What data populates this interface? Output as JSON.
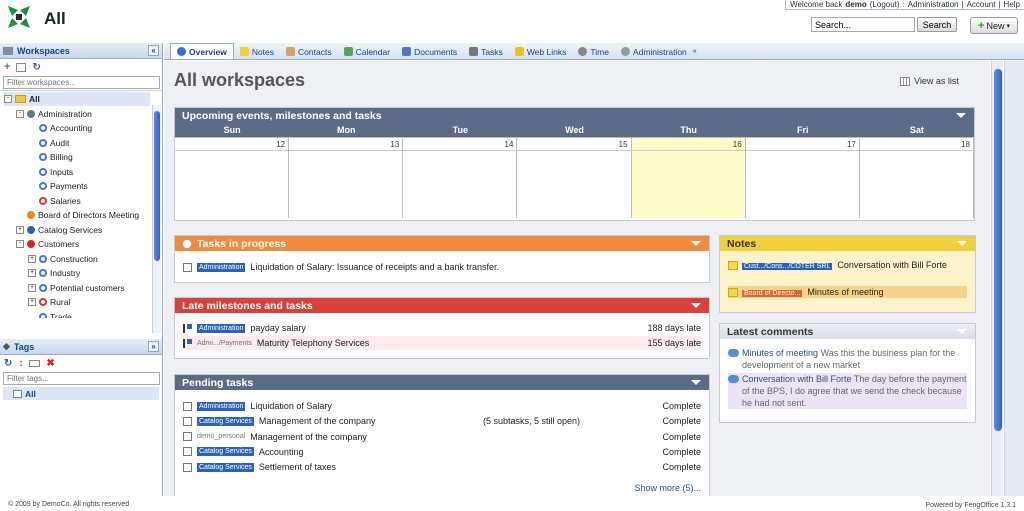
{
  "app": {
    "title": "All"
  },
  "userbar": {
    "welcome": "Welcome back",
    "user": "demo",
    "logout": "(Logout)",
    "sep1": ":",
    "admin": "Administration",
    "sep2": "|",
    "account": "Account",
    "sep3": "|",
    "help": "Help"
  },
  "search": {
    "value": "Search...",
    "button": "Search"
  },
  "new_button": {
    "label": "New"
  },
  "sidebar": {
    "workspaces_title": "Workspaces",
    "filter_placeholder": "Filter workspaces...",
    "tree": [
      {
        "label": "All",
        "level": 0,
        "exp": "-",
        "icon": "folder",
        "selected": true
      },
      {
        "label": "Administration",
        "level": 1,
        "exp": "-",
        "icon": "dot",
        "color": "#667788"
      },
      {
        "label": "Accounting",
        "level": 2,
        "exp": "",
        "icon": "ring",
        "color": "#4477cc"
      },
      {
        "label": "Audit",
        "level": 2,
        "exp": "",
        "icon": "ring",
        "color": "#4477cc"
      },
      {
        "label": "Billing",
        "level": 2,
        "exp": "",
        "icon": "ring",
        "color": "#4477cc"
      },
      {
        "label": "Inputs",
        "level": 2,
        "exp": "",
        "icon": "ring",
        "color": "#4477cc"
      },
      {
        "label": "Payments",
        "level": 2,
        "exp": "",
        "icon": "ring",
        "color": "#4477cc"
      },
      {
        "label": "Salaries",
        "level": 2,
        "exp": "",
        "icon": "ring",
        "color": "#dd3333"
      },
      {
        "label": "Board of Directors Meeting",
        "level": 1,
        "exp": "",
        "icon": "dot",
        "color": "#ee8822"
      },
      {
        "label": "Catalog Services",
        "level": 1,
        "exp": "+",
        "icon": "dot",
        "color": "#2d63b7"
      },
      {
        "label": "Customers",
        "level": 1,
        "exp": "-",
        "icon": "dot",
        "color": "#dd2222"
      },
      {
        "label": "Construction",
        "level": 2,
        "exp": "+",
        "icon": "ring",
        "color": "#4477cc"
      },
      {
        "label": "Industry",
        "level": 2,
        "exp": "+",
        "icon": "ring",
        "color": "#4477cc"
      },
      {
        "label": "Potential customers",
        "level": 2,
        "exp": "+",
        "icon": "ring",
        "color": "#4477cc"
      },
      {
        "label": "Rural",
        "level": 2,
        "exp": "+",
        "icon": "ring",
        "color": "#dd3333"
      },
      {
        "label": "Trade",
        "level": 2,
        "exp": "",
        "icon": "ring",
        "color": "#4477cc"
      }
    ],
    "tags_title": "Tags",
    "tags_filter_placeholder": "Filter tags...",
    "tags": [
      {
        "label": "All"
      }
    ]
  },
  "tabs": [
    {
      "label": "Overview",
      "icon": "globe-icon",
      "color": "#3a6fc4",
      "active": true
    },
    {
      "label": "Notes",
      "icon": "note-icon",
      "color": "#f2cf3c"
    },
    {
      "label": "Contacts",
      "icon": "contacts-icon",
      "color": "#d9a066"
    },
    {
      "label": "Calendar",
      "icon": "calendar-icon",
      "color": "#5aa25a"
    },
    {
      "label": "Documents",
      "icon": "documents-icon",
      "color": "#5577bb"
    },
    {
      "label": "Tasks",
      "icon": "tasks-icon",
      "color": "#777777"
    },
    {
      "label": "Web Links",
      "icon": "star-icon",
      "color": "#e8c22a"
    },
    {
      "label": "Time",
      "icon": "clock-icon",
      "color": "#888888"
    },
    {
      "label": "Administration",
      "icon": "gear-icon",
      "color": "#999999"
    }
  ],
  "main": {
    "title": "All workspaces",
    "view_as_list": "View as list"
  },
  "upcoming": {
    "title": "Upcoming events, milestones and tasks",
    "color": "#5b6b88",
    "days": [
      "Sun",
      "Mon",
      "Tue",
      "Wed",
      "Thu",
      "Fri",
      "Sat"
    ],
    "dates": [
      "12",
      "13",
      "14",
      "15",
      "16",
      "17",
      "18"
    ],
    "today_index": 4
  },
  "tasks_in_progress": {
    "title": "Tasks in progress",
    "color": "#f08a3c",
    "rows": [
      {
        "badge": "Administration",
        "text": "Liquidation of Salary: Issuance of receipts and a bank transfer."
      }
    ]
  },
  "late": {
    "title": "Late milestones and tasks",
    "color": "#d9403a",
    "rows": [
      {
        "badge": "Administration",
        "badge_style": "blue",
        "text": "payday salary",
        "right": "188 days late"
      },
      {
        "badge": "Admi.../Payments",
        "badge_style": "plain",
        "text": "Maturity Telephony Services",
        "right": "155 days late"
      }
    ]
  },
  "pending": {
    "title": "Pending tasks",
    "color": "#5b6b88",
    "rows": [
      {
        "badge": "Administration",
        "badge_style": "blue",
        "text": "Liquidation of Salary",
        "mid": "",
        "right": "Complete"
      },
      {
        "badge": "Catalog Services",
        "badge_style": "blue",
        "text": "Management of the company",
        "mid": "(5 subtasks, 5 still open)",
        "right": "Complete"
      },
      {
        "badge": "demo_personal",
        "badge_style": "plain",
        "text": "Management of the company",
        "mid": "",
        "right": "Complete"
      },
      {
        "badge": "Catalog Services",
        "badge_style": "blue",
        "text": "Accounting",
        "mid": "",
        "right": "Complete"
      },
      {
        "badge": "Catalog Services",
        "badge_style": "blue",
        "text": "Settlement of taxes",
        "mid": "",
        "right": "Complete"
      }
    ],
    "show_more": "Show more (5)..."
  },
  "notes": {
    "title": "Notes",
    "color": "#f2cf3c",
    "rows": [
      {
        "badge": "Cust.../Cons.../COTER SRL",
        "badge_style": "blue",
        "text": "Conversation with Bill Forte"
      },
      {
        "badge": "Board of Directo...",
        "badge_style": "orange",
        "text": "Minutes of meeting"
      }
    ]
  },
  "comments": {
    "title": "Latest comments",
    "color": "#5b6b88",
    "rows": [
      {
        "subject": "Minutes of meeting",
        "body": "Was this the business plan for the development of a new market"
      },
      {
        "subject": "Conversation with Bill Forte",
        "body": "The day before the payment of the BPS, I do agree that we send the check because he had not sent."
      }
    ]
  },
  "footer": {
    "left": "© 2009 by DemoCo. All rights reserved",
    "right": "Powered by FengOffice 1.3.1"
  }
}
